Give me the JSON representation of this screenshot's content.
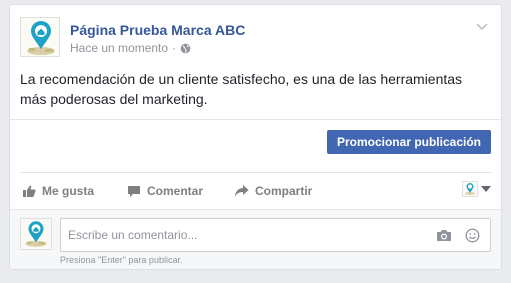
{
  "post": {
    "page_name": "Página Prueba Marca ABC",
    "timestamp": "Hace un momento",
    "separator": "·",
    "privacy_icon": "globe-icon",
    "text": "La recomendación de un cliente satisfecho, es una de las herramientas más poderosas del marketing.",
    "promote_label": "Promocionar publicación"
  },
  "actions": {
    "like_label": "Me gusta",
    "comment_label": "Comentar",
    "share_label": "Compartir"
  },
  "comment_box": {
    "placeholder": "Escribe un comentario...",
    "hint": "Presiona \"Enter\" para publicar."
  },
  "colors": {
    "page_name": "#365899",
    "promote_button": "#4267b2",
    "avatar_pin": "#1fa3c4",
    "text": "#1d2129",
    "muted": "#90949c"
  }
}
